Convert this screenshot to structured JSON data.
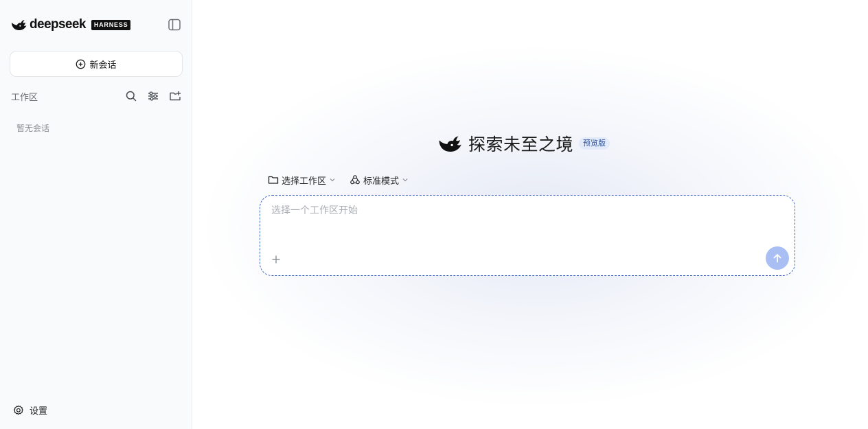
{
  "brand": {
    "name": "deepseek",
    "badge": "HARNESS"
  },
  "sidebar": {
    "new_chat_label": "新会话",
    "workspace_label": "工作区",
    "empty_text": "暂无会话",
    "settings_label": "设置"
  },
  "main": {
    "title": "探索未至之境",
    "badge": "预览版",
    "workspace_select_label": "选择工作区",
    "mode_select_label": "标准模式",
    "input_placeholder": "选择一个工作区开始"
  },
  "icons": {
    "logo": "whale-icon",
    "collapse": "sidebar-toggle-icon",
    "new_chat": "plus-circle-icon",
    "search": "search-icon",
    "filter": "sliders-icon",
    "new_folder": "folder-plus-icon",
    "settings": "gear-icon",
    "workspace": "folder-icon",
    "mode": "recycle-icon",
    "dropdown": "chevron-down-icon",
    "attach": "plus-icon",
    "send": "arrow-up-icon"
  },
  "colors": {
    "accent": "#3e64c2",
    "send_button": "#a9bff4",
    "badge_bg": "#e3ebfb",
    "badge_text": "#2f4f91",
    "sidebar_bg": "#f9fafb"
  }
}
